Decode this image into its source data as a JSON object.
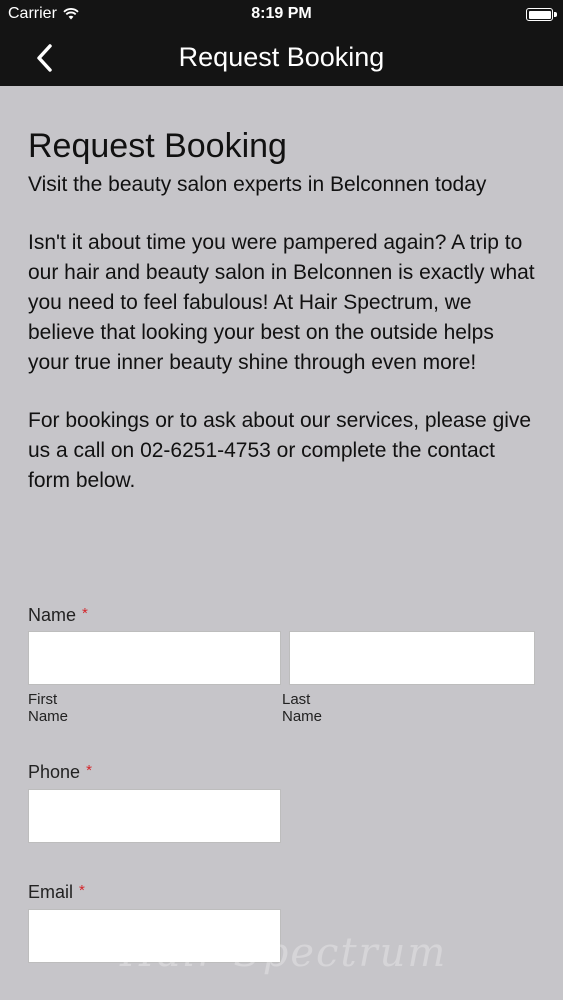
{
  "status_bar": {
    "carrier": "Carrier",
    "time": "8:19 PM"
  },
  "nav": {
    "title": "Request Booking",
    "back_icon": "chevron-left-icon"
  },
  "content": {
    "heading": "Request Booking",
    "subtitle": "Visit the beauty salon experts in Belconnen today",
    "paragraph1": "Isn't it about time you were pampered again? A trip to our hair and beauty salon in Belconnen is exactly what you need to feel fabulous! At Hair Spectrum, we believe that looking your best on the outside helps your true inner beauty shine through even more!",
    "paragraph2": "For bookings or to ask about our services, please give us a call on 02-6251-4753 or complete the contact form below."
  },
  "form": {
    "name": {
      "label": "Name",
      "required_mark": "*",
      "first_value": "",
      "last_value": "",
      "first_sublabel": "First Name",
      "last_sublabel": "Last Name"
    },
    "phone": {
      "label": "Phone",
      "required_mark": "*",
      "value": ""
    },
    "email": {
      "label": "Email",
      "required_mark": "*",
      "value": ""
    }
  },
  "watermark": "Hair Spectrum",
  "colors": {
    "background": "#c6c5c9",
    "bar": "#141414",
    "required": "#d4252a"
  }
}
